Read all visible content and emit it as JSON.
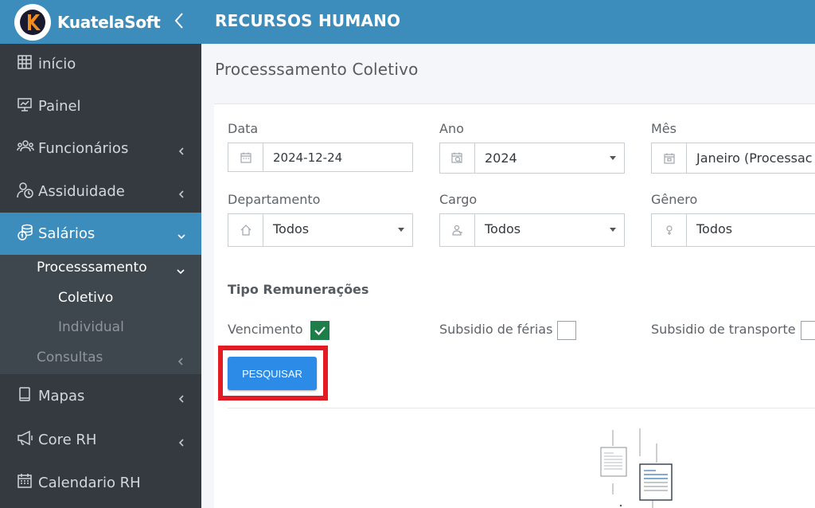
{
  "brand": {
    "name": "KuatelaSoft",
    "logo_letter": "K"
  },
  "header": {
    "title": "RECURSOS HUMANO"
  },
  "sidebar": {
    "items": [
      {
        "label": "início",
        "icon": "grid-icon"
      },
      {
        "label": "Painel",
        "icon": "presentation-icon"
      },
      {
        "label": "Funcionários",
        "icon": "users-icon"
      },
      {
        "label": "Assiduidade",
        "icon": "user-clock-icon"
      },
      {
        "label": "Salários",
        "icon": "coins-icon"
      },
      {
        "label": "Mapas",
        "icon": "book-icon"
      },
      {
        "label": "Core RH",
        "icon": "megaphone-icon"
      },
      {
        "label": "Calendario RH",
        "icon": "calendar-icon"
      }
    ],
    "submenu": {
      "processamento": "Processsamento",
      "coletivo": "Coletivo",
      "individual": "Individual",
      "consultas": "Consultas"
    }
  },
  "page": {
    "title": "Processsamento Coletivo"
  },
  "form": {
    "data": {
      "label": "Data",
      "value": "2024-12-24"
    },
    "ano": {
      "label": "Ano",
      "value": "2024"
    },
    "mes": {
      "label": "Mês",
      "value": "Janeiro (Processac"
    },
    "departamento": {
      "label": "Departamento",
      "value": "Todos"
    },
    "cargo": {
      "label": "Cargo",
      "value": "Todos"
    },
    "genero": {
      "label": "Gênero",
      "value": "Todos"
    }
  },
  "remuneracoes": {
    "title": "Tipo Remunerações",
    "vencimento": {
      "label": "Vencimento",
      "checked": true
    },
    "ferias": {
      "label": "Subsidio de férias",
      "checked": false
    },
    "transporte": {
      "label": "Subsidio de transporte",
      "checked": false
    }
  },
  "search_button": "PESQUISAR",
  "colors": {
    "primary": "#3c8dbc",
    "sidebar": "#343a40",
    "button": "#2c8be6",
    "highlight": "#e31b23",
    "check": "#1e7e4a"
  }
}
